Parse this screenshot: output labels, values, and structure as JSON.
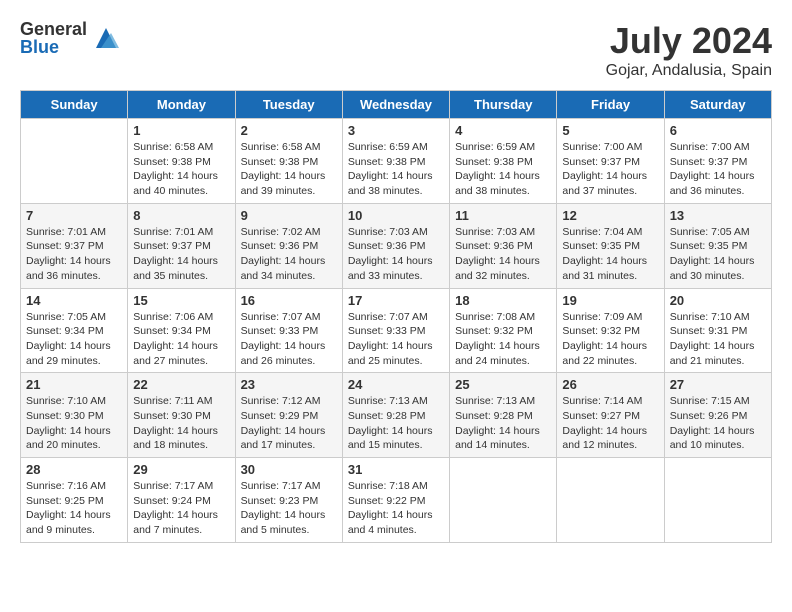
{
  "logo": {
    "general": "General",
    "blue": "Blue"
  },
  "title": {
    "month": "July 2024",
    "location": "Gojar, Andalusia, Spain"
  },
  "calendar": {
    "headers": [
      "Sunday",
      "Monday",
      "Tuesday",
      "Wednesday",
      "Thursday",
      "Friday",
      "Saturday"
    ],
    "weeks": [
      [
        {
          "day": "",
          "info": ""
        },
        {
          "day": "1",
          "info": "Sunrise: 6:58 AM\nSunset: 9:38 PM\nDaylight: 14 hours\nand 40 minutes."
        },
        {
          "day": "2",
          "info": "Sunrise: 6:58 AM\nSunset: 9:38 PM\nDaylight: 14 hours\nand 39 minutes."
        },
        {
          "day": "3",
          "info": "Sunrise: 6:59 AM\nSunset: 9:38 PM\nDaylight: 14 hours\nand 38 minutes."
        },
        {
          "day": "4",
          "info": "Sunrise: 6:59 AM\nSunset: 9:38 PM\nDaylight: 14 hours\nand 38 minutes."
        },
        {
          "day": "5",
          "info": "Sunrise: 7:00 AM\nSunset: 9:37 PM\nDaylight: 14 hours\nand 37 minutes."
        },
        {
          "day": "6",
          "info": "Sunrise: 7:00 AM\nSunset: 9:37 PM\nDaylight: 14 hours\nand 36 minutes."
        }
      ],
      [
        {
          "day": "7",
          "info": "Sunrise: 7:01 AM\nSunset: 9:37 PM\nDaylight: 14 hours\nand 36 minutes."
        },
        {
          "day": "8",
          "info": "Sunrise: 7:01 AM\nSunset: 9:37 PM\nDaylight: 14 hours\nand 35 minutes."
        },
        {
          "day": "9",
          "info": "Sunrise: 7:02 AM\nSunset: 9:36 PM\nDaylight: 14 hours\nand 34 minutes."
        },
        {
          "day": "10",
          "info": "Sunrise: 7:03 AM\nSunset: 9:36 PM\nDaylight: 14 hours\nand 33 minutes."
        },
        {
          "day": "11",
          "info": "Sunrise: 7:03 AM\nSunset: 9:36 PM\nDaylight: 14 hours\nand 32 minutes."
        },
        {
          "day": "12",
          "info": "Sunrise: 7:04 AM\nSunset: 9:35 PM\nDaylight: 14 hours\nand 31 minutes."
        },
        {
          "day": "13",
          "info": "Sunrise: 7:05 AM\nSunset: 9:35 PM\nDaylight: 14 hours\nand 30 minutes."
        }
      ],
      [
        {
          "day": "14",
          "info": "Sunrise: 7:05 AM\nSunset: 9:34 PM\nDaylight: 14 hours\nand 29 minutes."
        },
        {
          "day": "15",
          "info": "Sunrise: 7:06 AM\nSunset: 9:34 PM\nDaylight: 14 hours\nand 27 minutes."
        },
        {
          "day": "16",
          "info": "Sunrise: 7:07 AM\nSunset: 9:33 PM\nDaylight: 14 hours\nand 26 minutes."
        },
        {
          "day": "17",
          "info": "Sunrise: 7:07 AM\nSunset: 9:33 PM\nDaylight: 14 hours\nand 25 minutes."
        },
        {
          "day": "18",
          "info": "Sunrise: 7:08 AM\nSunset: 9:32 PM\nDaylight: 14 hours\nand 24 minutes."
        },
        {
          "day": "19",
          "info": "Sunrise: 7:09 AM\nSunset: 9:32 PM\nDaylight: 14 hours\nand 22 minutes."
        },
        {
          "day": "20",
          "info": "Sunrise: 7:10 AM\nSunset: 9:31 PM\nDaylight: 14 hours\nand 21 minutes."
        }
      ],
      [
        {
          "day": "21",
          "info": "Sunrise: 7:10 AM\nSunset: 9:30 PM\nDaylight: 14 hours\nand 20 minutes."
        },
        {
          "day": "22",
          "info": "Sunrise: 7:11 AM\nSunset: 9:30 PM\nDaylight: 14 hours\nand 18 minutes."
        },
        {
          "day": "23",
          "info": "Sunrise: 7:12 AM\nSunset: 9:29 PM\nDaylight: 14 hours\nand 17 minutes."
        },
        {
          "day": "24",
          "info": "Sunrise: 7:13 AM\nSunset: 9:28 PM\nDaylight: 14 hours\nand 15 minutes."
        },
        {
          "day": "25",
          "info": "Sunrise: 7:13 AM\nSunset: 9:28 PM\nDaylight: 14 hours\nand 14 minutes."
        },
        {
          "day": "26",
          "info": "Sunrise: 7:14 AM\nSunset: 9:27 PM\nDaylight: 14 hours\nand 12 minutes."
        },
        {
          "day": "27",
          "info": "Sunrise: 7:15 AM\nSunset: 9:26 PM\nDaylight: 14 hours\nand 10 minutes."
        }
      ],
      [
        {
          "day": "28",
          "info": "Sunrise: 7:16 AM\nSunset: 9:25 PM\nDaylight: 14 hours\nand 9 minutes."
        },
        {
          "day": "29",
          "info": "Sunrise: 7:17 AM\nSunset: 9:24 PM\nDaylight: 14 hours\nand 7 minutes."
        },
        {
          "day": "30",
          "info": "Sunrise: 7:17 AM\nSunset: 9:23 PM\nDaylight: 14 hours\nand 5 minutes."
        },
        {
          "day": "31",
          "info": "Sunrise: 7:18 AM\nSunset: 9:22 PM\nDaylight: 14 hours\nand 4 minutes."
        },
        {
          "day": "",
          "info": ""
        },
        {
          "day": "",
          "info": ""
        },
        {
          "day": "",
          "info": ""
        }
      ]
    ]
  }
}
